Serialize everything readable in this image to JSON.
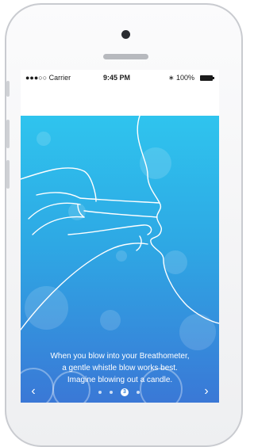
{
  "status_bar": {
    "signal": "●●●○○ Carrier",
    "time": "9:45 PM",
    "bluetooth": "∗",
    "battery": "100%"
  },
  "instructions": {
    "lines": [
      "When you blow into your Breathometer,",
      "a gentle whistle blow works best.",
      "Imagine blowing out a candle."
    ]
  },
  "pager": {
    "current": "3",
    "prev_icon": "‹",
    "next_icon": "›"
  },
  "colors": {
    "sky_top": "#2fc4ee",
    "sky_bottom": "#3a78d6"
  }
}
